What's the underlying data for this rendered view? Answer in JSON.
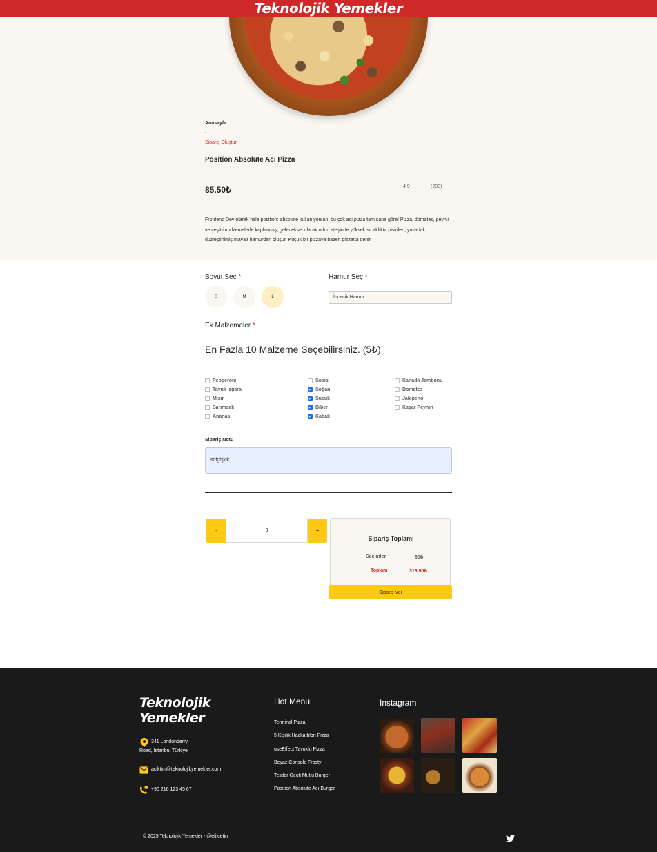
{
  "header": {
    "brand": "Teknolojik Yemekler",
    "bg_color": "#ce2829"
  },
  "breadcrumb": {
    "home": "Anasayfa",
    "separator": "-",
    "current": "Sipariş Oluştur"
  },
  "product": {
    "name": "Position Absolute Acı Pizza",
    "price": "85.50₺",
    "rating": "4.9",
    "reviews": "(200)",
    "description": "Frontend Dev olarak hala position: absolute kullanıyorsan, bu çok acı pizza tam sana göre! Pizza, domates, peynir ve çeşitli malzemelerle kaplanmış, geleneksel olarak odun ateşinde yüksek sıcaklıkta pişirilen, yuvarlak, düzleştirilmiş mayalı hamurdan oluşur. Küçük bir pizzaya bazen pizzetta denir."
  },
  "form": {
    "size_label": "Boyut Seç",
    "sizes": [
      "S",
      "M",
      "L"
    ],
    "selected_size": "L",
    "dough_label": "Hamur Seç",
    "dough_value": "İncecik Hamur",
    "extras_label": "Ek Malzemeler",
    "extras_title": "En Fazla 10 Malzeme Seçebilirsiniz. (5₺)",
    "required_mark": "*",
    "toppings": [
      {
        "label": "Pepperoni",
        "checked": false
      },
      {
        "label": "Tavuk Izgara",
        "checked": false
      },
      {
        "label": "Mısır",
        "checked": false
      },
      {
        "label": "Sarımsak",
        "checked": false
      },
      {
        "label": "Ananas",
        "checked": false
      },
      {
        "label": "Sosis",
        "checked": false
      },
      {
        "label": "Soğan",
        "checked": true
      },
      {
        "label": "Sucuk",
        "checked": true
      },
      {
        "label": "Biber",
        "checked": true
      },
      {
        "label": "Kabak",
        "checked": true
      },
      {
        "label": "Kanada Jambonu",
        "checked": false
      },
      {
        "label": "Domates",
        "checked": false
      },
      {
        "label": "Jalepeno",
        "checked": false
      },
      {
        "label": "Kaşar Peyniri",
        "checked": false
      }
    ],
    "note_label": "Sipariş Notu",
    "note_value": "sdfghjklk"
  },
  "order": {
    "minus": "-",
    "quantity": "3",
    "plus": "+",
    "summary_title": "Sipariş Toplamı",
    "selections_label": "Seçimler",
    "selections_value": "60₺",
    "total_label": "Toplam",
    "total_value": "316.50₺",
    "submit": "Sipariş Ver",
    "accent_color": "#fdc913"
  },
  "footer": {
    "logo_line1": "Teknolojik",
    "logo_line2": "Yemekler",
    "address_line1": "341 Londonderry",
    "address_line2": "Road, Istanbul Türkiye",
    "email": "aciktim@teknolojikyemekler.com",
    "phone": "+90 216 123 45 67",
    "hot_menu_title": "Hot Menu",
    "hot_menu": [
      "Terminal Pizza",
      "5 Kişilik Hackathlon Pizza",
      "useEffect Tavuklu Pizza",
      "Beyaz Console Frosty",
      "Testler Geçti Mutlu Burger",
      "Position Absolute Acı Burger"
    ],
    "instagram_title": "Instagram",
    "copyright": "© 2025 Teknolojik Yemekler - @elifcetin"
  }
}
